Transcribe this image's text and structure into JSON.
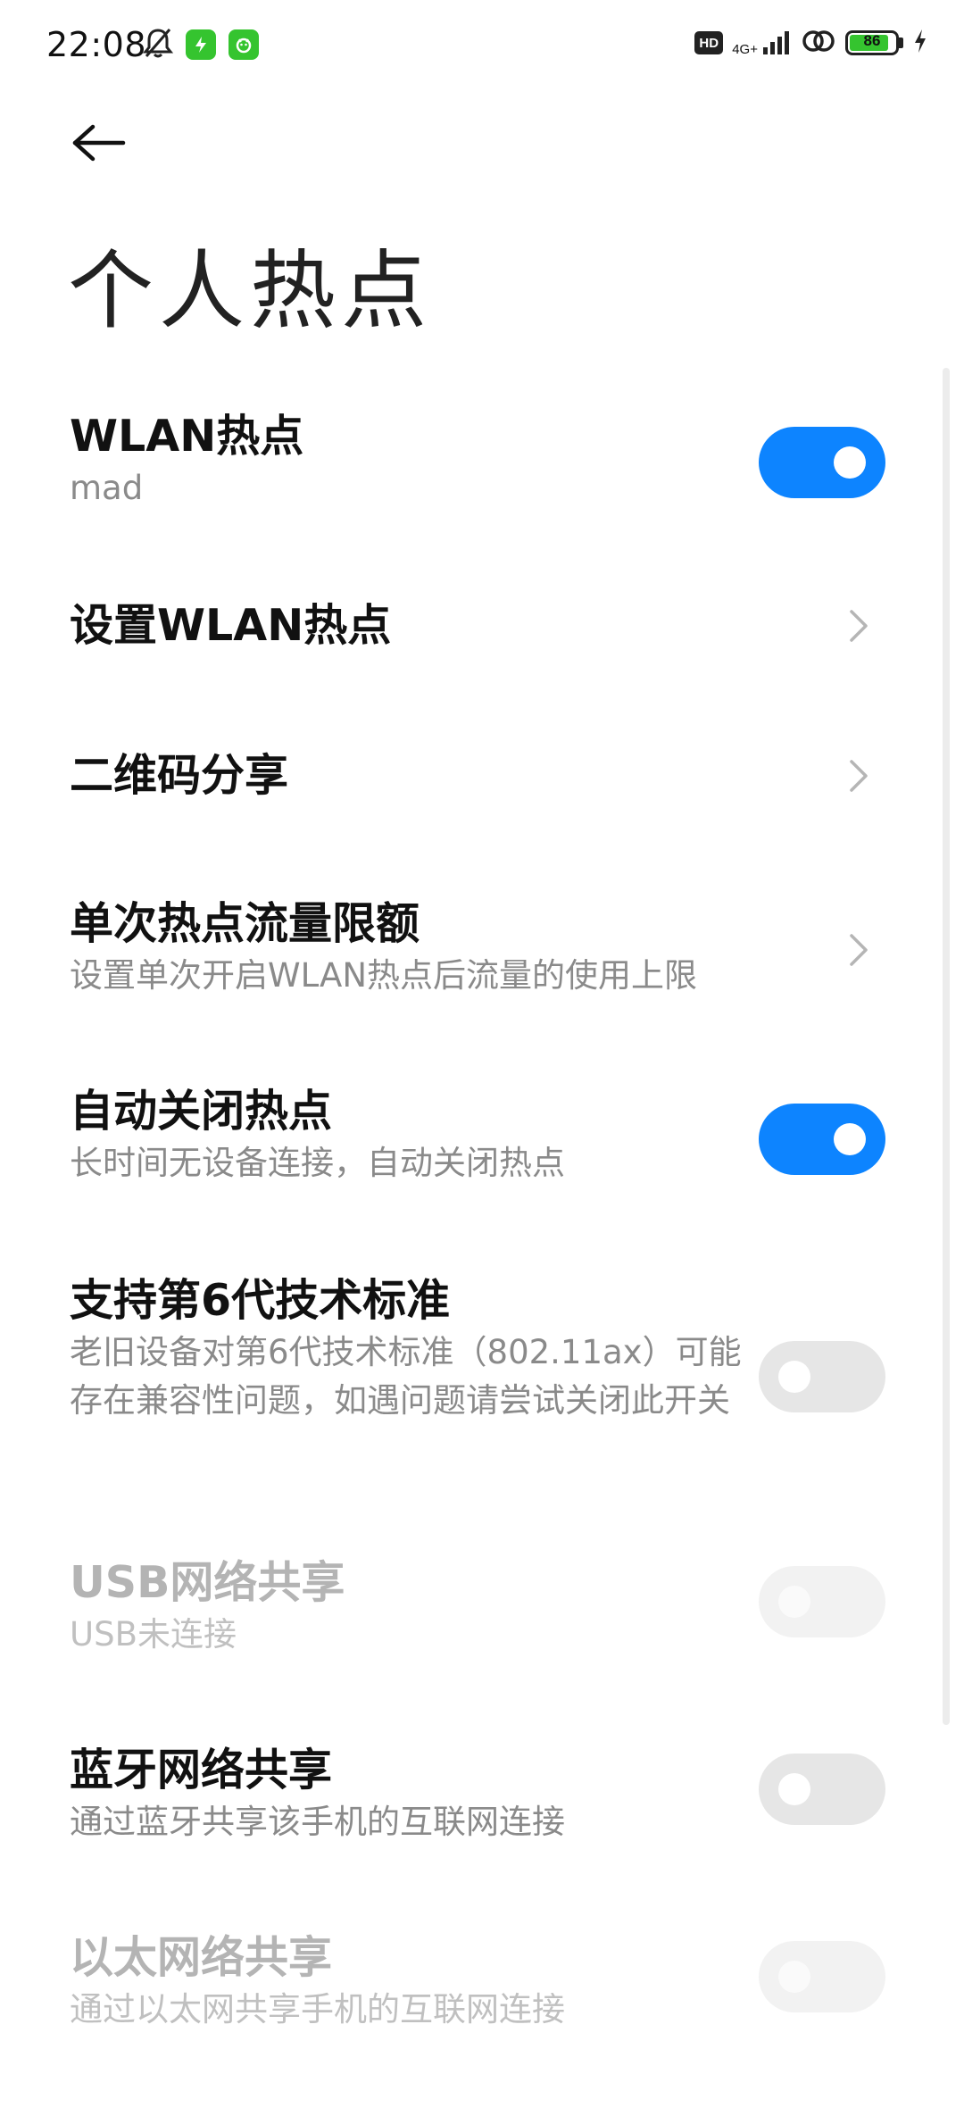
{
  "status_bar": {
    "time": "22:08",
    "network": "4G+",
    "battery_level": "86",
    "battery_fraction": 0.86,
    "hd_label": "HD",
    "icons": [
      "mute-bell-icon",
      "app-notification-icon",
      "app-notification-icon",
      "hd-icon",
      "signal-icon",
      "hotspot-link-icon",
      "battery-icon",
      "charging-icon"
    ]
  },
  "header": {
    "title": "个人热点",
    "back_icon": "back-arrow-icon"
  },
  "settings": {
    "wlan_hotspot": {
      "title": "WLAN热点",
      "subtitle": "mad",
      "state": "on"
    },
    "setup_wlan_hotspot": {
      "title": "设置WLAN热点"
    },
    "qr_share": {
      "title": "二维码分享"
    },
    "data_limit": {
      "title": "单次热点流量限额",
      "subtitle": "设置单次开启WLAN热点后流量的使用上限"
    },
    "auto_off": {
      "title": "自动关闭热点",
      "subtitle": "长时间无设备连接，自动关闭热点",
      "state": "on"
    },
    "wifi6": {
      "title": "支持第6代技术标准",
      "subtitle": "老旧设备对第6代技术标准（802.11ax）可能存在兼容性问题，如遇问题请尝试关闭此开关",
      "state": "off"
    },
    "usb_share": {
      "title": "USB网络共享",
      "subtitle": "USB未连接",
      "state": "disabled"
    },
    "bt_share": {
      "title": "蓝牙网络共享",
      "subtitle": "通过蓝牙共享该手机的互联网连接",
      "state": "off"
    },
    "ethernet_share": {
      "title": "以太网络共享",
      "subtitle": "通过以太网共享手机的互联网连接",
      "state": "disabled"
    }
  },
  "colors": {
    "accent": "#0d84ff",
    "toggle_off": "#e6e6e6",
    "battery_green": "#35c42f",
    "disabled_text": "#b4b4b4"
  }
}
